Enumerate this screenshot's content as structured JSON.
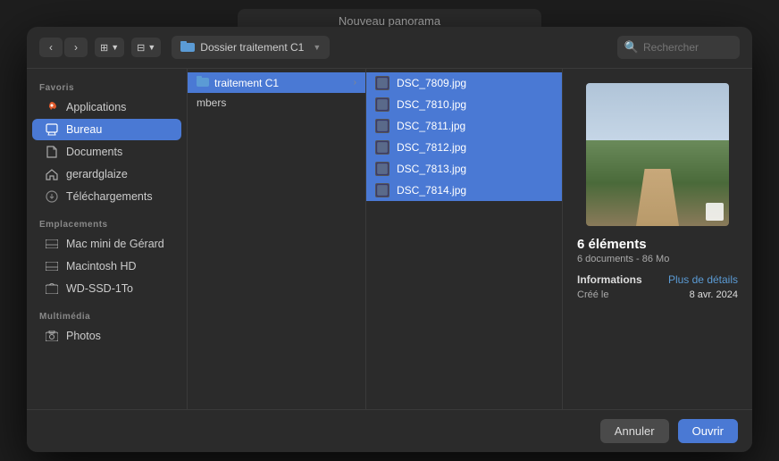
{
  "titlebar": {
    "label": "Nouveau panorama"
  },
  "toolbar": {
    "back_label": "‹",
    "forward_label": "›",
    "view_columns_label": "⊞",
    "view_grid_label": "⊟",
    "folder_name": "Dossier traitement C1",
    "search_placeholder": "Rechercher"
  },
  "sidebar": {
    "favorites_label": "Favoris",
    "locations_label": "Emplacements",
    "multimedia_label": "Multimédia",
    "items": [
      {
        "id": "applications",
        "label": "Applications",
        "icon": "rocket"
      },
      {
        "id": "bureau",
        "label": "Bureau",
        "icon": "desktop",
        "active": true
      },
      {
        "id": "documents",
        "label": "Documents",
        "icon": "doc"
      },
      {
        "id": "gerardglaize",
        "label": "gerardglaize",
        "icon": "home"
      },
      {
        "id": "telechargements",
        "label": "Téléchargements",
        "icon": "download"
      }
    ],
    "locations": [
      {
        "id": "mac-mini",
        "label": "Mac mini de Gérard",
        "icon": "drive"
      },
      {
        "id": "macintosh-hd",
        "label": "Macintosh HD",
        "icon": "drive"
      },
      {
        "id": "wd-ssd",
        "label": "WD-SSD-1To",
        "icon": "drive-eject"
      }
    ],
    "multimedia": [
      {
        "id": "photos",
        "label": "Photos",
        "icon": "camera"
      }
    ]
  },
  "column_pane": {
    "folder_label": "traitement C1",
    "extra_item": "mbers"
  },
  "file_list": {
    "files": [
      {
        "name": "DSC_7809.jpg",
        "selected": true
      },
      {
        "name": "DSC_7810.jpg",
        "selected": true
      },
      {
        "name": "DSC_7811.jpg",
        "selected": true
      },
      {
        "name": "DSC_7812.jpg",
        "selected": true
      },
      {
        "name": "DSC_7813.jpg",
        "selected": true
      },
      {
        "name": "DSC_7814.jpg",
        "selected": true
      }
    ]
  },
  "preview": {
    "count_label": "6 éléments",
    "subtitle": "6 documents - 86 Mo",
    "info_label": "Informations",
    "details_link": "Plus de détails",
    "created_label": "Créé le",
    "created_date": "8 avr. 2024"
  },
  "footer": {
    "cancel_label": "Annuler",
    "open_label": "Ouvrir"
  }
}
